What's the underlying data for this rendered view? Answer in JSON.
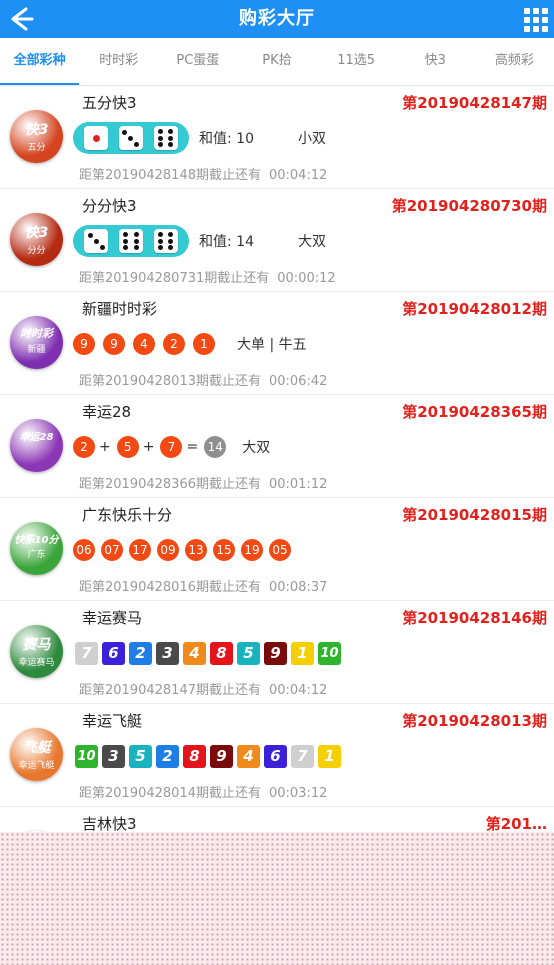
{
  "header": {
    "title": "购彩大厅"
  },
  "tabs": [
    {
      "label": "全部彩种",
      "active": true
    },
    {
      "label": "时时彩"
    },
    {
      "label": "PC蛋蛋"
    },
    {
      "label": "PK拾"
    },
    {
      "label": "11选5"
    },
    {
      "label": "快3"
    },
    {
      "label": "高频彩"
    }
  ],
  "lotteries": [
    {
      "name": "五分快3",
      "period": "第20190428147期",
      "logo_text": "快3",
      "logo_sub": "五分",
      "logo_color": "#d4441f",
      "dice": [
        1,
        3,
        6
      ],
      "sum": "和值: 10",
      "form": "小双",
      "countdown_label": "距第20190428148期截止还有",
      "countdown": "00:04:12"
    },
    {
      "name": "分分快3",
      "period": "第201904280730期",
      "logo_text": "快3",
      "logo_sub": "分分",
      "logo_color": "#b52a12",
      "dice": [
        3,
        6,
        6
      ],
      "sum": "和值: 14",
      "form": "大双",
      "countdown_label": "距第201904280731期截止还有",
      "countdown": "00:00:12"
    },
    {
      "name": "新疆时时彩",
      "period": "第20190428012期",
      "logo_text": "时时彩",
      "logo_sub": "新疆",
      "logo_color": "#7e2fb0",
      "balls": [
        "9",
        "9",
        "4",
        "2",
        "1"
      ],
      "result": "大单 | 牛五",
      "countdown_label": "距第20190428013期截止还有",
      "countdown": "00:06:42"
    },
    {
      "name": "幸运28",
      "period": "第20190428365期",
      "logo_text": "幸运28",
      "logo_sub": "",
      "logo_color": "#8b36b5",
      "balls": [
        "2",
        "5",
        "7"
      ],
      "total": "14",
      "result": "大双",
      "countdown_label": "距第20190428366期截止还有",
      "countdown": "00:01:12"
    },
    {
      "name": "广东快乐十分",
      "period": "第20190428015期",
      "logo_text": "快乐10分",
      "logo_sub": "广东",
      "logo_color": "#3aa53a",
      "balls": [
        "06",
        "07",
        "17",
        "09",
        "13",
        "15",
        "19",
        "05"
      ],
      "countdown_label": "距第20190428016期截止还有",
      "countdown": "00:08:37"
    },
    {
      "name": "幸运赛马",
      "period": "第20190428146期",
      "logo_text": "赛马",
      "logo_sub": "幸运赛马",
      "logo_color": "#2d8a3e",
      "squares": [
        "7",
        "6",
        "2",
        "3",
        "4",
        "8",
        "5",
        "9",
        "1",
        "10"
      ],
      "countdown_label": "距第20190428147期截止还有",
      "countdown": "00:04:12"
    },
    {
      "name": "幸运飞艇",
      "period": "第20190428013期",
      "logo_text": "飞艇",
      "logo_sub": "幸运飞艇",
      "logo_color": "#e8772e",
      "squares": [
        "10",
        "3",
        "5",
        "2",
        "8",
        "9",
        "4",
        "6",
        "7",
        "1"
      ],
      "countdown_label": "距第20190428014期截止还有",
      "countdown": "00:03:12"
    },
    {
      "name": "吉林快3",
      "period": "第201…"
    }
  ],
  "number_colors": {
    "1": "#f5d000",
    "2": "#1e7ee6",
    "3": "#4a4a4a",
    "4": "#f08a1a",
    "5": "#19b3c0",
    "6": "#3b22d8",
    "7": "#cfcfcf",
    "8": "#e5131b",
    "9": "#7a0b0b",
    "10": "#2fb52d"
  },
  "colors": {
    "header": "#1e8ff5",
    "period": "#e2211c",
    "ball": "#f24a12",
    "dice_pill": "#34cad2"
  }
}
